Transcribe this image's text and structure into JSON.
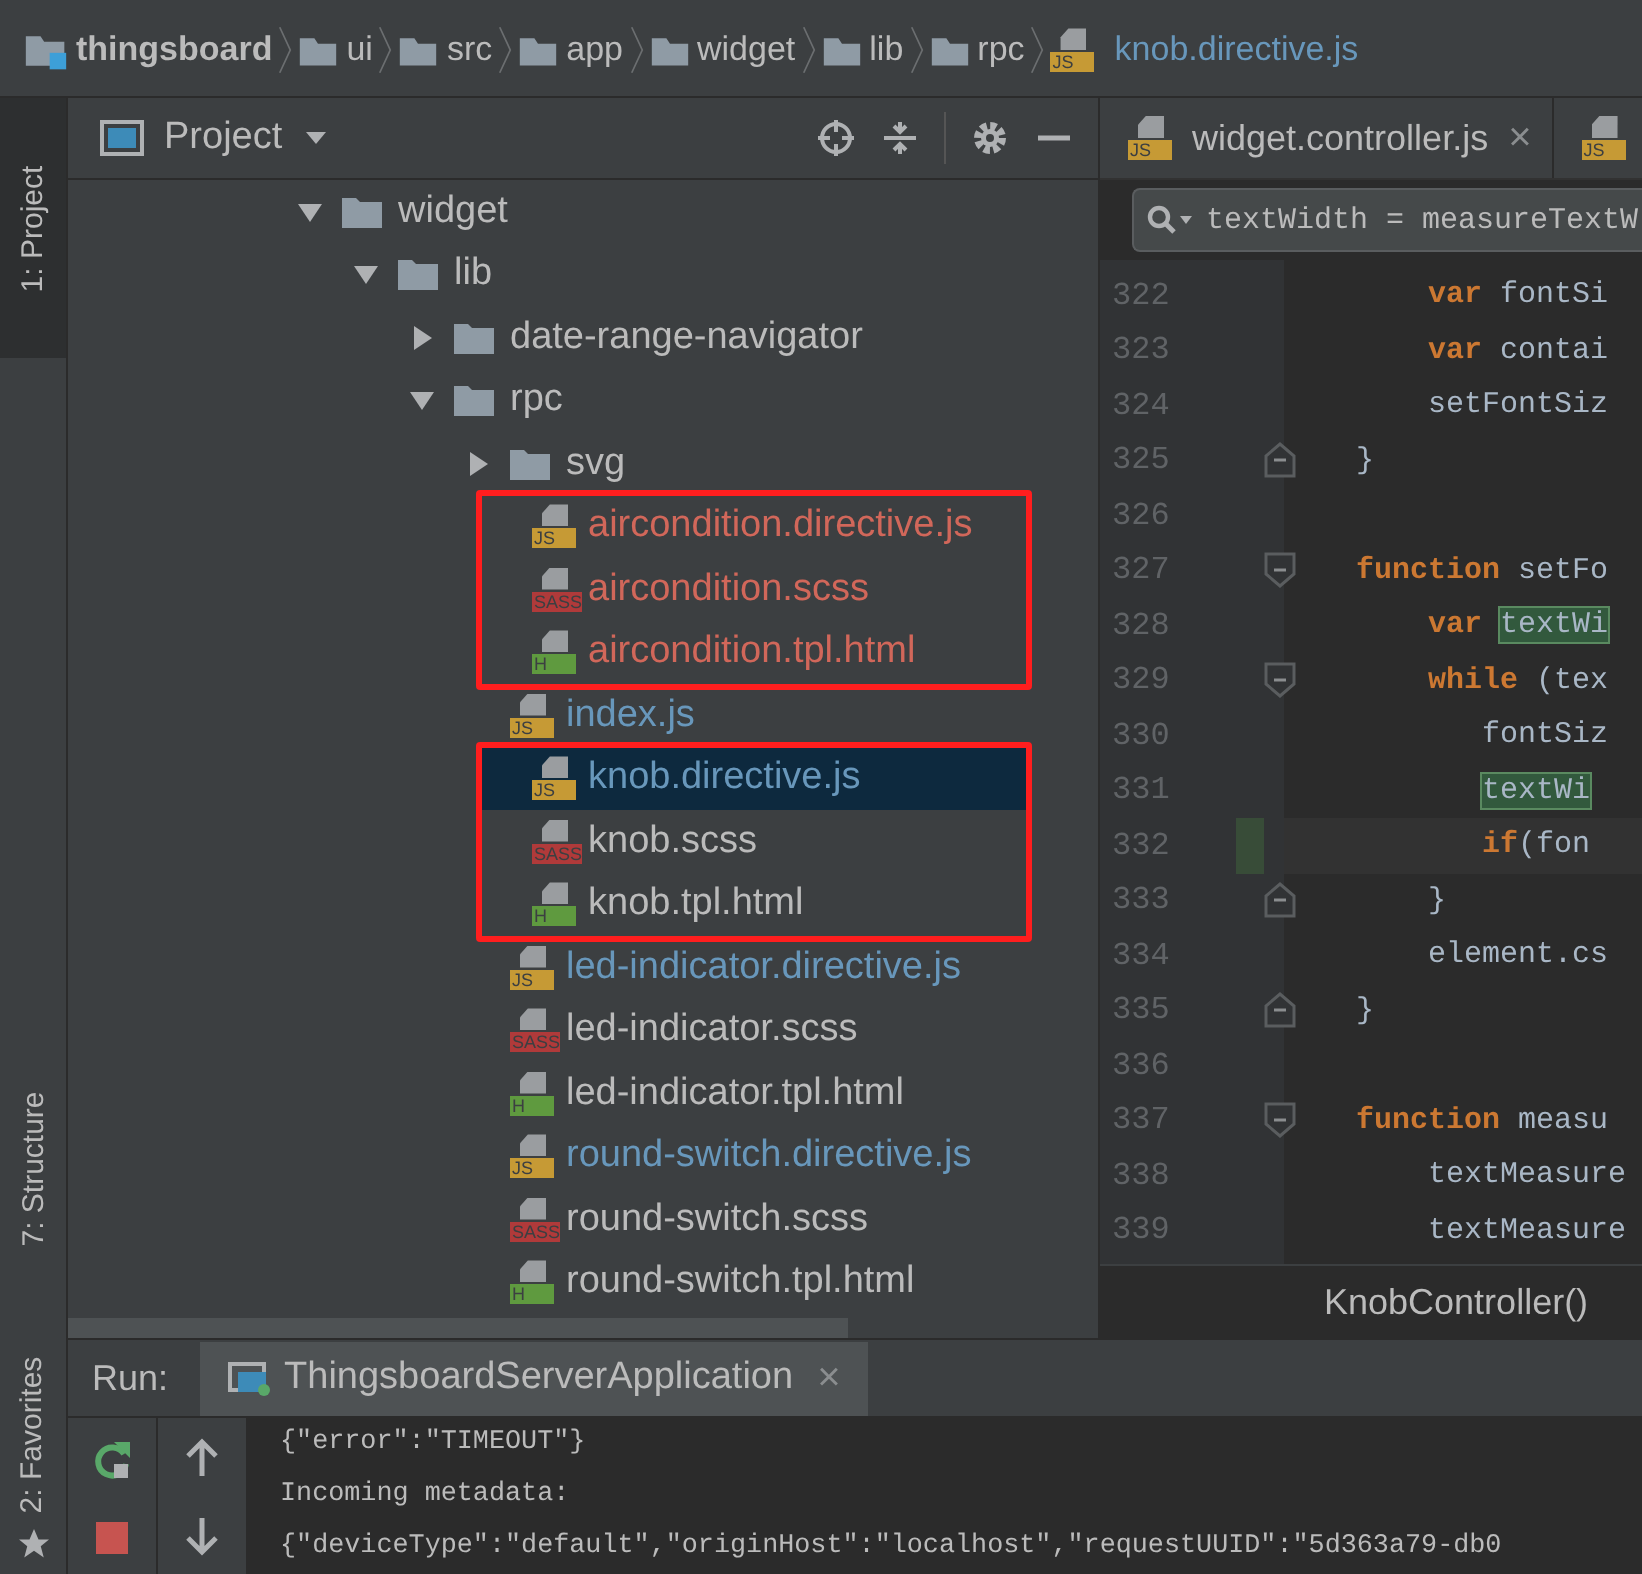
{
  "breadcrumb": [
    {
      "label": "thingsboard",
      "kind": "project"
    },
    {
      "label": "ui",
      "kind": "folder"
    },
    {
      "label": "src",
      "kind": "folder"
    },
    {
      "label": "app",
      "kind": "folder"
    },
    {
      "label": "widget",
      "kind": "folder"
    },
    {
      "label": "lib",
      "kind": "folder"
    },
    {
      "label": "rpc",
      "kind": "folder"
    },
    {
      "label": "knob.directive.js",
      "kind": "js",
      "badge": "JS"
    }
  ],
  "side_tabs": [
    {
      "label": "1: Project",
      "selected": true
    },
    {
      "label": "7: Structure",
      "selected": false
    },
    {
      "label": "2: Favorites",
      "selected": false
    }
  ],
  "project_panel": {
    "title": "Project",
    "tree": [
      {
        "label": "widget",
        "expanded": true,
        "children": [
          {
            "label": "lib",
            "expanded": true,
            "children": [
              {
                "label": "date-range-navigator",
                "expanded": false
              },
              {
                "label": "rpc",
                "expanded": true,
                "children": [
                  {
                    "label": "svg",
                    "expanded": false
                  },
                  {
                    "label": "aircondition.directive.js",
                    "kind": "js",
                    "badge": "JS",
                    "color": "#d1675a",
                    "boxed": true,
                    "selected": false
                  },
                  {
                    "label": "aircondition.scss",
                    "kind": "sass",
                    "badge": "SASS",
                    "color": "#d1675a",
                    "boxed": true,
                    "selected": false
                  },
                  {
                    "label": "aircondition.tpl.html",
                    "kind": "html",
                    "badge": "H",
                    "color": "#d1675a",
                    "boxed": true,
                    "selected": false
                  },
                  {
                    "label": "index.js",
                    "kind": "js",
                    "badge": "JS",
                    "color": "#6897bb",
                    "boxed": false,
                    "selected": false
                  },
                  {
                    "label": "knob.directive.js",
                    "kind": "js",
                    "badge": "JS",
                    "color": "#6897bb",
                    "boxed": true,
                    "selected": true
                  },
                  {
                    "label": "knob.scss",
                    "kind": "sass",
                    "badge": "SASS",
                    "color": "#bbbbbb",
                    "boxed": true,
                    "selected": false
                  },
                  {
                    "label": "knob.tpl.html",
                    "kind": "html",
                    "badge": "H",
                    "color": "#bbbbbb",
                    "boxed": true,
                    "selected": false
                  },
                  {
                    "label": "led-indicator.directive.js",
                    "kind": "js",
                    "badge": "JS",
                    "color": "#6897bb",
                    "boxed": false,
                    "selected": false
                  },
                  {
                    "label": "led-indicator.scss",
                    "kind": "sass",
                    "badge": "SASS",
                    "color": "#bbbbbb",
                    "boxed": false,
                    "selected": false
                  },
                  {
                    "label": "led-indicator.tpl.html",
                    "kind": "html",
                    "badge": "H",
                    "color": "#bbbbbb",
                    "boxed": false,
                    "selected": false
                  },
                  {
                    "label": "round-switch.directive.js",
                    "kind": "js",
                    "badge": "JS",
                    "color": "#6897bb",
                    "boxed": false,
                    "selected": false
                  },
                  {
                    "label": "round-switch.scss",
                    "kind": "sass",
                    "badge": "SASS",
                    "color": "#bbbbbb",
                    "boxed": false,
                    "selected": false
                  },
                  {
                    "label": "round-switch.tpl.html",
                    "kind": "html",
                    "badge": "H",
                    "color": "#bbbbbb",
                    "boxed": false,
                    "selected": false
                  }
                ]
              }
            ]
          }
        ]
      }
    ]
  },
  "editor": {
    "tabs": [
      {
        "label": "widget.controller.js",
        "kind": "js",
        "badge": "JS",
        "close": "×"
      },
      {
        "kind": "js",
        "badge": "JS"
      }
    ],
    "search": {
      "value": "textWidth = measureTextW"
    },
    "lines": [
      {
        "number": "322",
        "fold_start": false,
        "fold_end": false,
        "tokens": [
          {
            "kind": "keyword",
            "text": "    var"
          },
          {
            "kind": "plain",
            "text": " fontSi"
          }
        ]
      },
      {
        "number": "323",
        "fold_start": false,
        "fold_end": false,
        "tokens": [
          {
            "kind": "keyword",
            "text": "    var"
          },
          {
            "kind": "plain",
            "text": " contai"
          }
        ]
      },
      {
        "number": "324",
        "fold_start": false,
        "fold_end": false,
        "tokens": [
          {
            "kind": "plain",
            "text": "    setFontSiz"
          }
        ]
      },
      {
        "number": "325",
        "fold_start": false,
        "fold_end": true,
        "tokens": [
          {
            "kind": "plain",
            "text": "}"
          }
        ]
      },
      {
        "number": "326",
        "fold_start": false,
        "fold_end": false
      },
      {
        "number": "327",
        "fold_start": true,
        "fold_end": false,
        "tokens": [
          {
            "kind": "keyword",
            "text": "function"
          },
          {
            "kind": "plain",
            "text": " setFo"
          }
        ]
      },
      {
        "number": "328",
        "fold_start": false,
        "fold_end": false,
        "tokens": [
          {
            "kind": "keyword",
            "text": "    var"
          },
          {
            "kind": "match",
            "text": " textWi"
          }
        ]
      },
      {
        "number": "329",
        "fold_start": true,
        "fold_end": false,
        "tokens": [
          {
            "kind": "keyword",
            "text": "    while"
          },
          {
            "kind": "plain",
            "text": " (tex"
          }
        ]
      },
      {
        "number": "330",
        "fold_start": false,
        "fold_end": false,
        "tokens": [
          {
            "kind": "plain",
            "text": "       fontSiz"
          }
        ]
      },
      {
        "number": "331",
        "fold_start": false,
        "fold_end": false,
        "tokens": [
          {
            "kind": "match",
            "text": "       textWi"
          }
        ]
      },
      {
        "number": "332",
        "fold_start": false,
        "fold_end": false,
        "current": true,
        "tokens": [
          {
            "kind": "keyword",
            "text": "       if"
          },
          {
            "kind": "plain",
            "text": "(fon"
          }
        ]
      },
      {
        "number": "333",
        "fold_start": false,
        "fold_end": true,
        "tokens": [
          {
            "kind": "plain",
            "text": "    }"
          }
        ]
      },
      {
        "number": "334",
        "fold_start": false,
        "fold_end": false,
        "tokens": [
          {
            "kind": "plain",
            "text": "    element.cs"
          }
        ]
      },
      {
        "number": "335",
        "fold_start": false,
        "fold_end": true,
        "tokens": [
          {
            "kind": "plain",
            "text": "}"
          }
        ]
      },
      {
        "number": "336",
        "fold_start": false,
        "fold_end": false
      },
      {
        "number": "337",
        "fold_start": true,
        "fold_end": false,
        "tokens": [
          {
            "kind": "keyword",
            "text": "function"
          },
          {
            "kind": "plain",
            "text": " measu"
          }
        ]
      },
      {
        "number": "338",
        "fold_start": false,
        "fold_end": false,
        "tokens": [
          {
            "kind": "plain",
            "text": "    textMeasure"
          }
        ]
      },
      {
        "number": "339",
        "fold_start": false,
        "fold_end": false,
        "tokens": [
          {
            "kind": "plain",
            "text": "    textMeasure"
          }
        ]
      }
    ],
    "footer": "KnobController()"
  },
  "run": {
    "label": "Run:",
    "tabs": [
      {
        "label": "ThingsboardServerApplication",
        "selected": true,
        "close": "×"
      }
    ],
    "console": [
      "{\"error\":\"TIMEOUT\"}",
      "Incoming metadata:",
      "{\"deviceType\":\"default\",\"originHost\":\"localhost\",\"requestUUID\":\"5d363a79-db0"
    ]
  }
}
